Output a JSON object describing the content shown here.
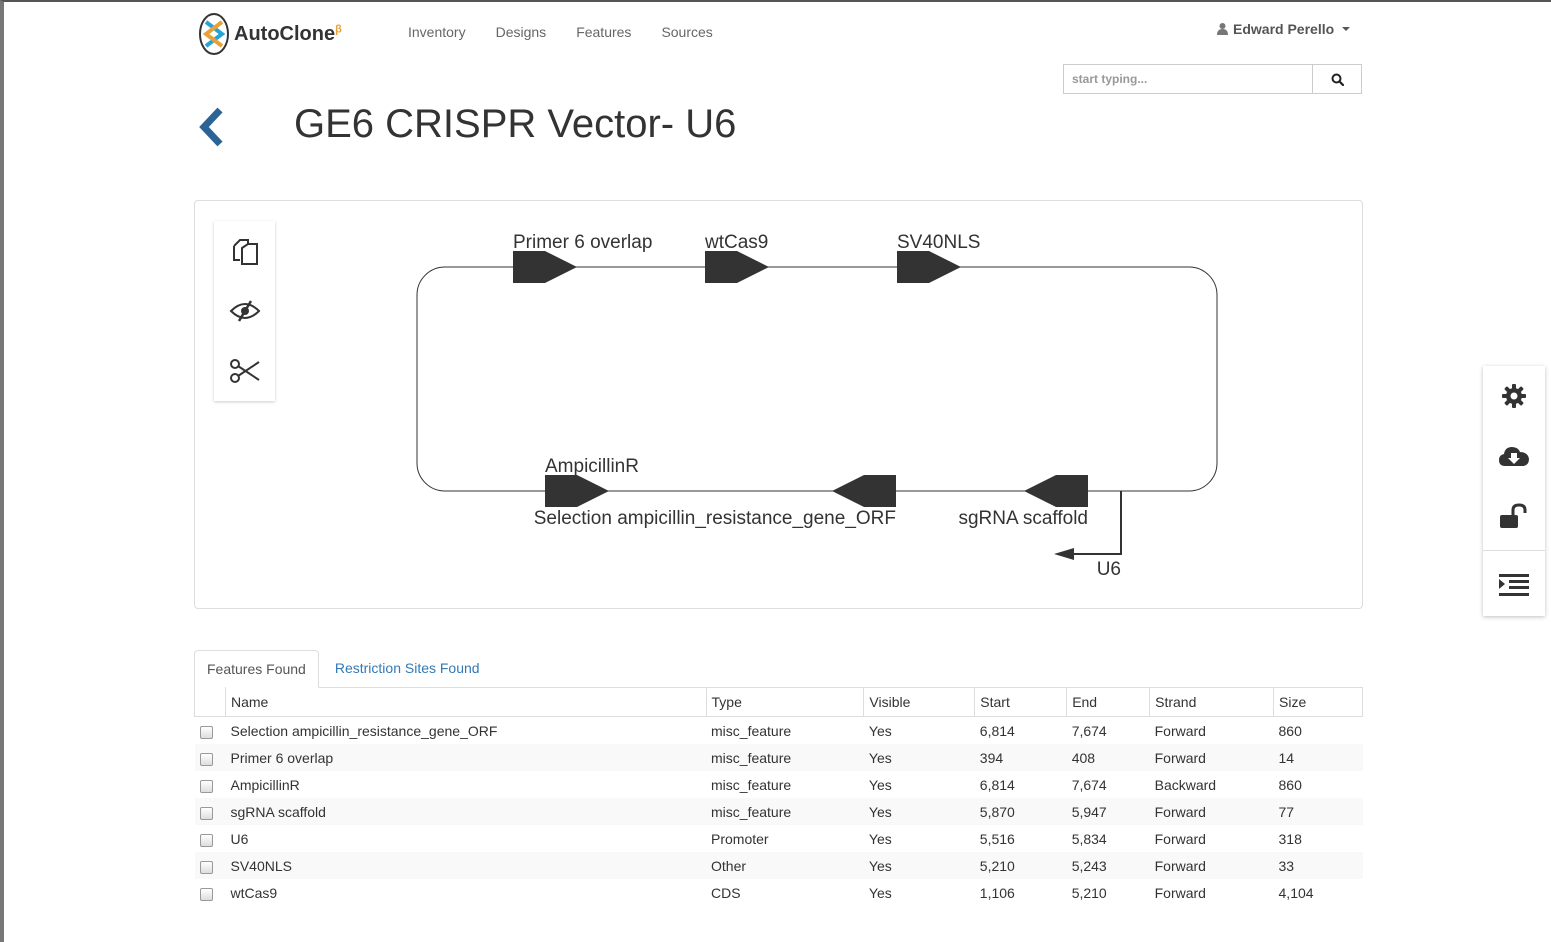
{
  "app": {
    "name": "AutoClone",
    "badge": "β"
  },
  "nav": {
    "items": [
      "Inventory",
      "Designs",
      "Features",
      "Sources"
    ]
  },
  "user": {
    "name": "Edward Perello"
  },
  "search": {
    "placeholder": "start typing..."
  },
  "page": {
    "title": "GE6 CRISPR Vector- U6"
  },
  "diagram": {
    "top_features": [
      "Primer 6 overlap",
      "wtCas9",
      "SV40NLS"
    ],
    "bottom_features": [
      "AmpicillinR",
      "Selection ampicillin_resistance_gene_ORF",
      "sgRNA scaffold"
    ],
    "promoter": "U6"
  },
  "tools": {
    "left": [
      "copy-icon",
      "eye-slash-icon",
      "scissors-icon"
    ],
    "right": [
      "gear-icon",
      "cloud-download-icon",
      "unlock-icon",
      "indent-icon"
    ]
  },
  "tabs": [
    {
      "label": "Features Found",
      "active": true
    },
    {
      "label": "Restriction Sites Found",
      "active": false
    }
  ],
  "table": {
    "columns": [
      "Name",
      "Type",
      "Visible",
      "Start",
      "End",
      "Strand",
      "Size"
    ],
    "rows": [
      [
        "Selection ampicillin_resistance_gene_ORF",
        "misc_feature",
        "Yes",
        "6,814",
        "7,674",
        "Forward",
        "860"
      ],
      [
        "Primer 6 overlap",
        "misc_feature",
        "Yes",
        "394",
        "408",
        "Forward",
        "14"
      ],
      [
        "AmpicillinR",
        "misc_feature",
        "Yes",
        "6,814",
        "7,674",
        "Backward",
        "860"
      ],
      [
        "sgRNA scaffold",
        "misc_feature",
        "Yes",
        "5,870",
        "5,947",
        "Forward",
        "77"
      ],
      [
        "U6",
        "Promoter",
        "Yes",
        "5,516",
        "5,834",
        "Forward",
        "318"
      ],
      [
        "SV40NLS",
        "Other",
        "Yes",
        "5,210",
        "5,243",
        "Forward",
        "33"
      ],
      [
        "wtCas9",
        "CDS",
        "Yes",
        "1,106",
        "5,210",
        "Forward",
        "4,104"
      ]
    ]
  },
  "colors": {
    "link": "#337ab7",
    "feature": "#333333",
    "logo_orange": "#e8a13a",
    "logo_blue": "#29a3d6"
  }
}
